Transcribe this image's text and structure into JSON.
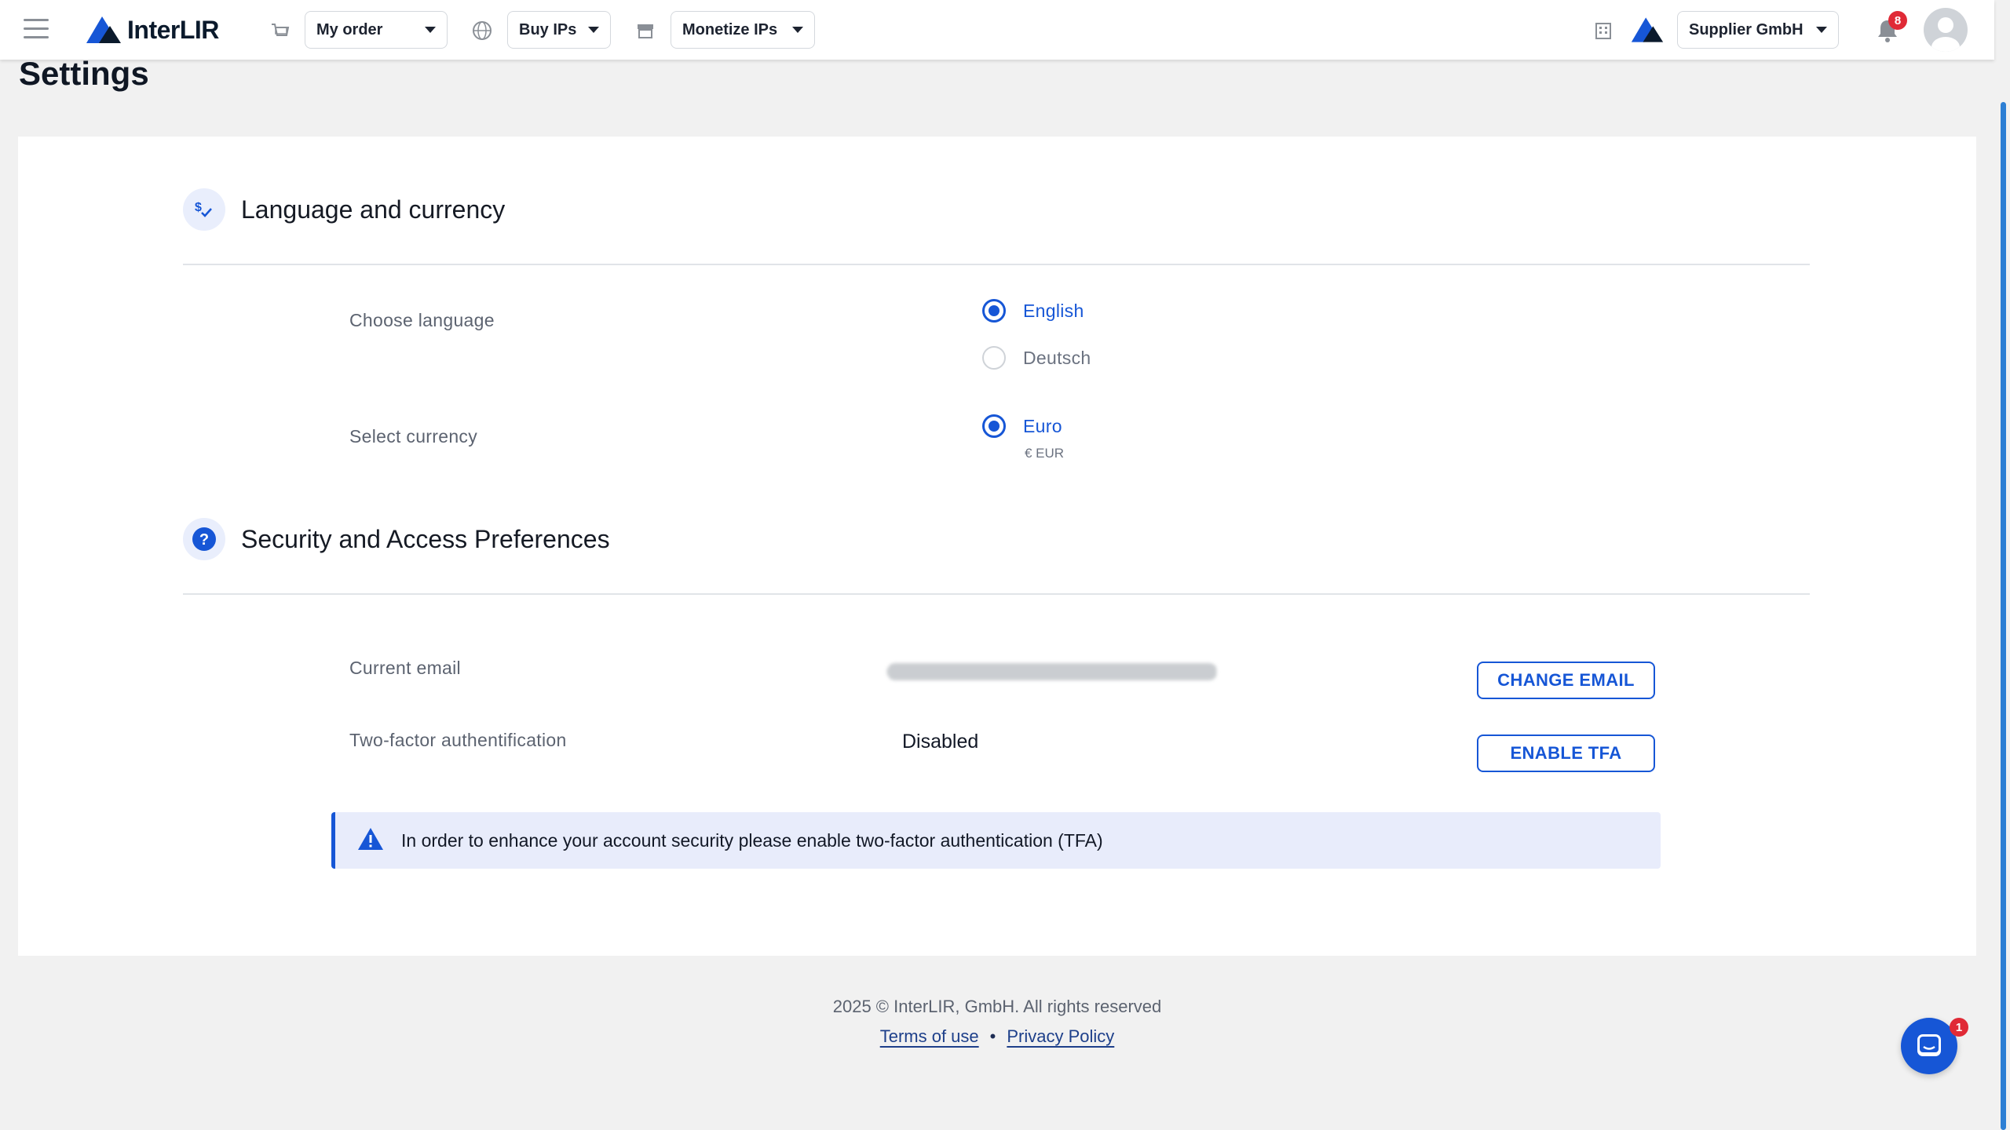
{
  "header": {
    "brand": "InterLIR",
    "nav": [
      {
        "label": "My order",
        "icon": "cart-icon"
      },
      {
        "label": "Buy IPs",
        "icon": "globe-icon"
      },
      {
        "label": "Monetize IPs",
        "icon": "store-icon"
      }
    ],
    "company": {
      "label": "Supplier GmbH",
      "icon": "building-icon"
    },
    "notifications_count": "8"
  },
  "page": {
    "title": "Settings"
  },
  "sections": {
    "language_currency": {
      "title": "Language and currency",
      "icon": "currency-check-icon",
      "choose_language_label": "Choose language",
      "languages": [
        {
          "label": "English",
          "selected": true
        },
        {
          "label": "Deutsch",
          "selected": false
        }
      ],
      "select_currency_label": "Select currency",
      "currency": {
        "label": "Euro",
        "sub": "€ EUR",
        "selected": true
      }
    },
    "security": {
      "title": "Security and Access Preferences",
      "icon": "question-icon",
      "current_email_label": "Current email",
      "change_email_button": "CHANGE EMAIL",
      "tfa_label": "Two-factor authentification",
      "tfa_value": "Disabled",
      "enable_tfa_button": "ENABLE TFA",
      "alert_text": "In order to enhance your account security please enable two-factor authentication (TFA)"
    }
  },
  "footer": {
    "copyright": "2025 © InterLIR, GmbH. All rights reserved",
    "terms": "Terms of use",
    "separator": "•",
    "privacy": "Privacy Policy"
  },
  "chat": {
    "badge": "1"
  },
  "colors": {
    "accent": "#1656d6",
    "badge": "#e02a36",
    "alert_bg": "#e8ecfb"
  }
}
